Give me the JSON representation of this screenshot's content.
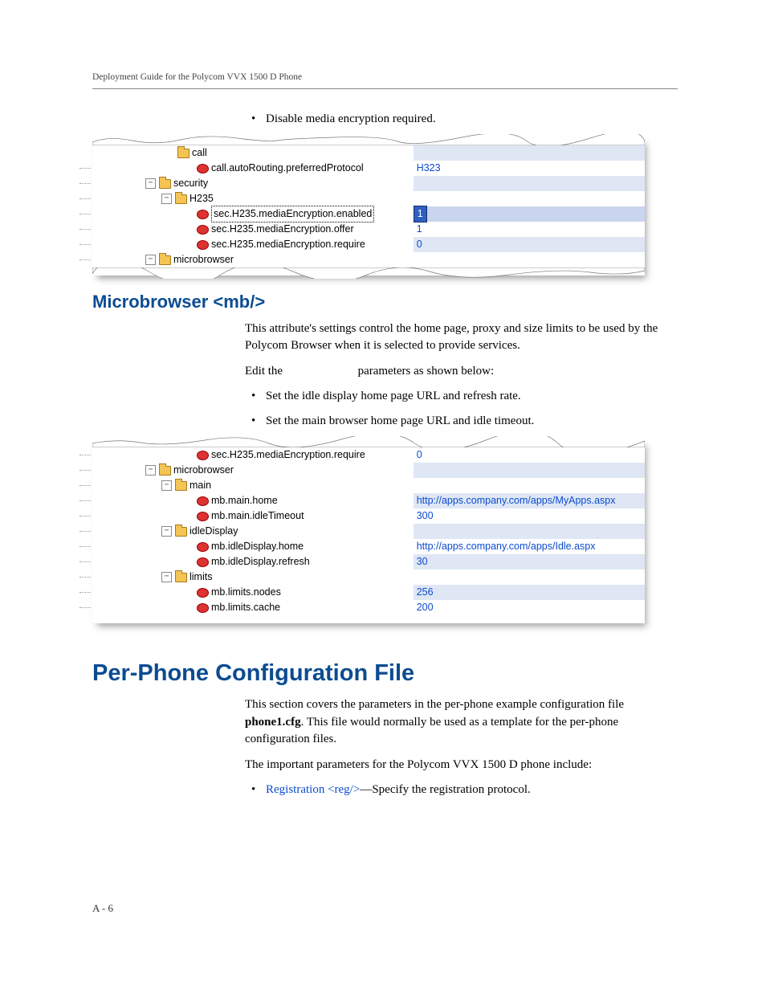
{
  "header": "Deployment Guide for the Polycom VVX 1500 D Phone",
  "top_bullet": "Disable media encryption required.",
  "tree1": {
    "top_fragment": "call",
    "items": [
      {
        "kind": "param",
        "label": "call.autoRouting.preferredProtocol",
        "value": "H323"
      },
      {
        "kind": "folder",
        "label": "security",
        "exp": "−"
      },
      {
        "kind": "folder",
        "label": "H235",
        "exp": "−"
      },
      {
        "kind": "param",
        "label": "sec.H235.mediaEncryption.enabled",
        "value": "1",
        "selected": true
      },
      {
        "kind": "param",
        "label": "sec.H235.mediaEncryption.offer",
        "value": "1"
      },
      {
        "kind": "param",
        "label": "sec.H235.mediaEncryption.require",
        "value": "0"
      },
      {
        "kind": "folder",
        "label": "microbrowser",
        "exp": "−"
      }
    ]
  },
  "mb_heading": "Microbrowser <mb/>",
  "mb_p1": "This attribute's settings control the home page, proxy and size limits to be used by the Polycom Browser when it is selected to provide services.",
  "mb_p2a": "Edit the ",
  "mb_p2b": " parameters as shown below:",
  "mb_bullets": [
    "Set the idle display home page URL and refresh rate.",
    "Set the main browser home page URL and idle timeout."
  ],
  "tree2": {
    "top_fragment": "sec.H235.mediaEncryption.require",
    "top_value": "0",
    "items": [
      {
        "kind": "folder",
        "label": "microbrowser",
        "exp": "−"
      },
      {
        "kind": "folder",
        "label": "main",
        "exp": "−"
      },
      {
        "kind": "param",
        "label": "mb.main.home",
        "value": "http://apps.company.com/apps/MyApps.aspx"
      },
      {
        "kind": "param",
        "label": "mb.main.idleTimeout",
        "value": "300"
      },
      {
        "kind": "folder",
        "label": "idleDisplay",
        "exp": "−"
      },
      {
        "kind": "param",
        "label": "mb.idleDisplay.home",
        "value": "http://apps.company.com/apps/Idle.aspx"
      },
      {
        "kind": "param",
        "label": "mb.idleDisplay.refresh",
        "value": "30"
      },
      {
        "kind": "folder",
        "label": "limits",
        "exp": "−"
      },
      {
        "kind": "param",
        "label": "mb.limits.nodes",
        "value": "256"
      },
      {
        "kind": "param",
        "label": "mb.limits.cache",
        "value": "200"
      }
    ]
  },
  "h1": "Per-Phone Configuration File",
  "pp_p1a": "This section covers the parameters in the per-phone example configuration file ",
  "pp_p1b": "phone1.cfg",
  "pp_p1c": ". This file would normally be used as a template for the per-phone configuration files.",
  "pp_p2": "The important parameters for the Polycom VVX 1500 D phone include:",
  "pp_bullet_link": "Registration <reg/>",
  "pp_bullet_tail": "—Specify the registration protocol.",
  "footer": "A - 6"
}
